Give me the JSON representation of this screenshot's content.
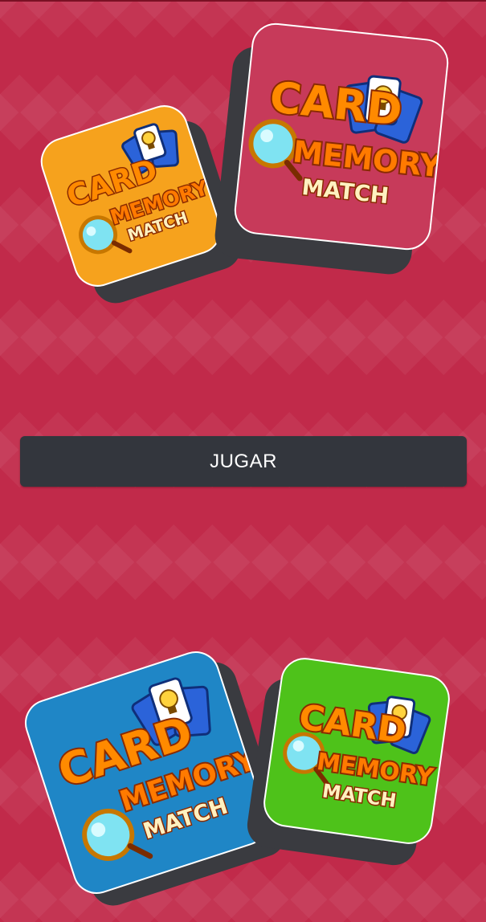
{
  "app": {
    "background_color": "#c12a4a"
  },
  "main": {
    "play_button_label": "JUGAR"
  },
  "tiles": [
    {
      "name": "orange",
      "color": "#f6a21d",
      "logo": {
        "line1": "CARD",
        "line2": "MEMORY",
        "line3": "MATCH"
      }
    },
    {
      "name": "magenta",
      "color": "#c73a5a",
      "logo": {
        "line1": "CARD",
        "line2": "MEMORY",
        "line3": "MATCH"
      }
    },
    {
      "name": "blue",
      "color": "#1f86c6",
      "logo": {
        "line1": "CARD",
        "line2": "MEMORY",
        "line3": "MATCH"
      }
    },
    {
      "name": "green",
      "color": "#4ec21a",
      "logo": {
        "line1": "CARD",
        "line2": "MEMORY",
        "line3": "MATCH"
      }
    }
  ],
  "icons": [
    "magnifier-icon",
    "card-icon",
    "lightbulb-icon"
  ]
}
